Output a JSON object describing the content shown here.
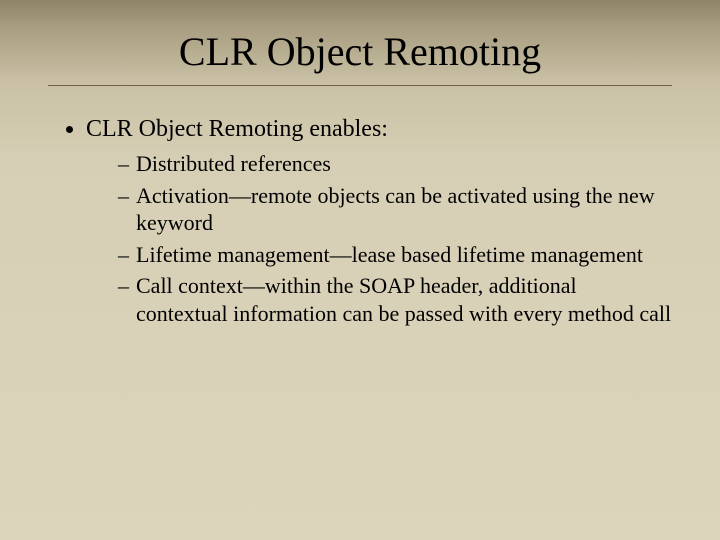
{
  "slide": {
    "title": "CLR Object Remoting",
    "bullet": "CLR Object Remoting enables:",
    "subitems": [
      "Distributed references",
      "Activation—remote objects can be activated using the new keyword",
      "Lifetime management—lease based lifetime management",
      "Call context—within the SOAP header, additional contextual information can be passed with every method call"
    ]
  }
}
